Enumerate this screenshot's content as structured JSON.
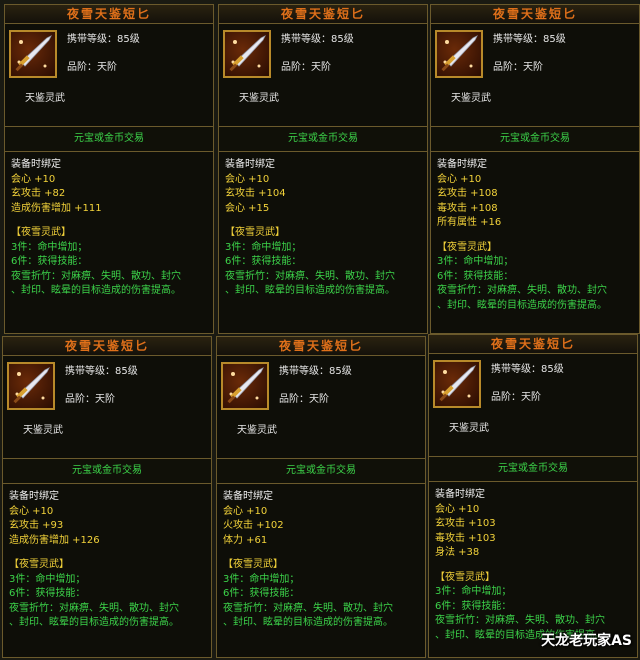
{
  "cards": [
    {
      "title": "夜雪天鉴短匕",
      "level": "携带等级：85级",
      "grade": "品阶：天阶",
      "series": "天鉴灵武",
      "trade": "元宝或金币交易",
      "bind": "装备时绑定",
      "stats": [
        "会心 +10",
        "玄攻击 +82",
        "造成伤害增加 +111"
      ],
      "set_name": "【夜雪灵武】",
      "set3": "3件：命中增加；",
      "set6": "6件：获得技能：",
      "skill1": "夜雪折竹：对麻痹、失明、散功、封穴",
      "skill2": "、封印、眩晕的目标造成的伤害提高。"
    },
    {
      "title": "夜雪天鉴短匕",
      "level": "携带等级：85级",
      "grade": "品阶：天阶",
      "series": "天鉴灵武",
      "trade": "元宝或金币交易",
      "bind": "装备时绑定",
      "stats": [
        "会心 +10",
        "玄攻击 +104",
        "会心 +15"
      ],
      "set_name": "【夜雪灵武】",
      "set3": "3件：命中增加；",
      "set6": "6件：获得技能：",
      "skill1": "夜雪折竹：对麻痹、失明、散功、封穴",
      "skill2": "、封印、眩晕的目标造成的伤害提高。"
    },
    {
      "title": "夜雪天鉴短匕",
      "level": "携带等级：85级",
      "grade": "品阶：天阶",
      "series": "天鉴灵武",
      "trade": "元宝或金币交易",
      "bind": "装备时绑定",
      "stats": [
        "会心 +10",
        "玄攻击 +108",
        "毒攻击 +108",
        "所有属性 +16"
      ],
      "set_name": "【夜雪灵武】",
      "set3": "3件：命中增加；",
      "set6": "6件：获得技能：",
      "skill1": "夜雪折竹：对麻痹、失明、散功、封穴",
      "skill2": "、封印、眩晕的目标造成的伤害提高。"
    },
    {
      "title": "夜雪天鉴短匕",
      "level": "携带等级：85级",
      "grade": "品阶：天阶",
      "series": "天鉴灵武",
      "trade": "元宝或金币交易",
      "bind": "装备时绑定",
      "stats": [
        "会心 +10",
        "玄攻击 +93",
        "造成伤害增加 +126"
      ],
      "set_name": "【夜雪灵武】",
      "set3": "3件：命中增加；",
      "set6": "6件：获得技能：",
      "skill1": "夜雪折竹：对麻痹、失明、散功、封穴",
      "skill2": "、封印、眩晕的目标造成的伤害提高。"
    },
    {
      "title": "夜雪天鉴短匕",
      "level": "携带等级：85级",
      "grade": "品阶：天阶",
      "series": "天鉴灵武",
      "trade": "元宝或金币交易",
      "bind": "装备时绑定",
      "stats": [
        "会心 +10",
        "火攻击 +102",
        "体力 +61"
      ],
      "set_name": "【夜雪灵武】",
      "set3": "3件：命中增加；",
      "set6": "6件：获得技能：",
      "skill1": "夜雪折竹：对麻痹、失明、散功、封穴",
      "skill2": "、封印、眩晕的目标造成的伤害提高。"
    },
    {
      "title": "夜雪天鉴短匕",
      "level": "携带等级：85级",
      "grade": "品阶：天阶",
      "series": "天鉴灵武",
      "trade": "元宝或金币交易",
      "bind": "装备时绑定",
      "stats": [
        "会心 +10",
        "玄攻击 +103",
        "毒攻击 +103",
        "身法 +38"
      ],
      "set_name": "【夜雪灵武】",
      "set3": "3件：命中增加；",
      "set6": "6件：获得技能：",
      "skill1": "夜雪折竹：对麻痹、失明、散功、封穴",
      "skill2": "、封印、眩晕的目标造成的伤害提高。"
    }
  ],
  "watermark": "天龙老玩家AS",
  "colors": {
    "title": "#e0701a",
    "stat": "#f2d23a",
    "set": "#3cd44a",
    "border": "#6b5a2c"
  },
  "icon": "dagger-icon"
}
